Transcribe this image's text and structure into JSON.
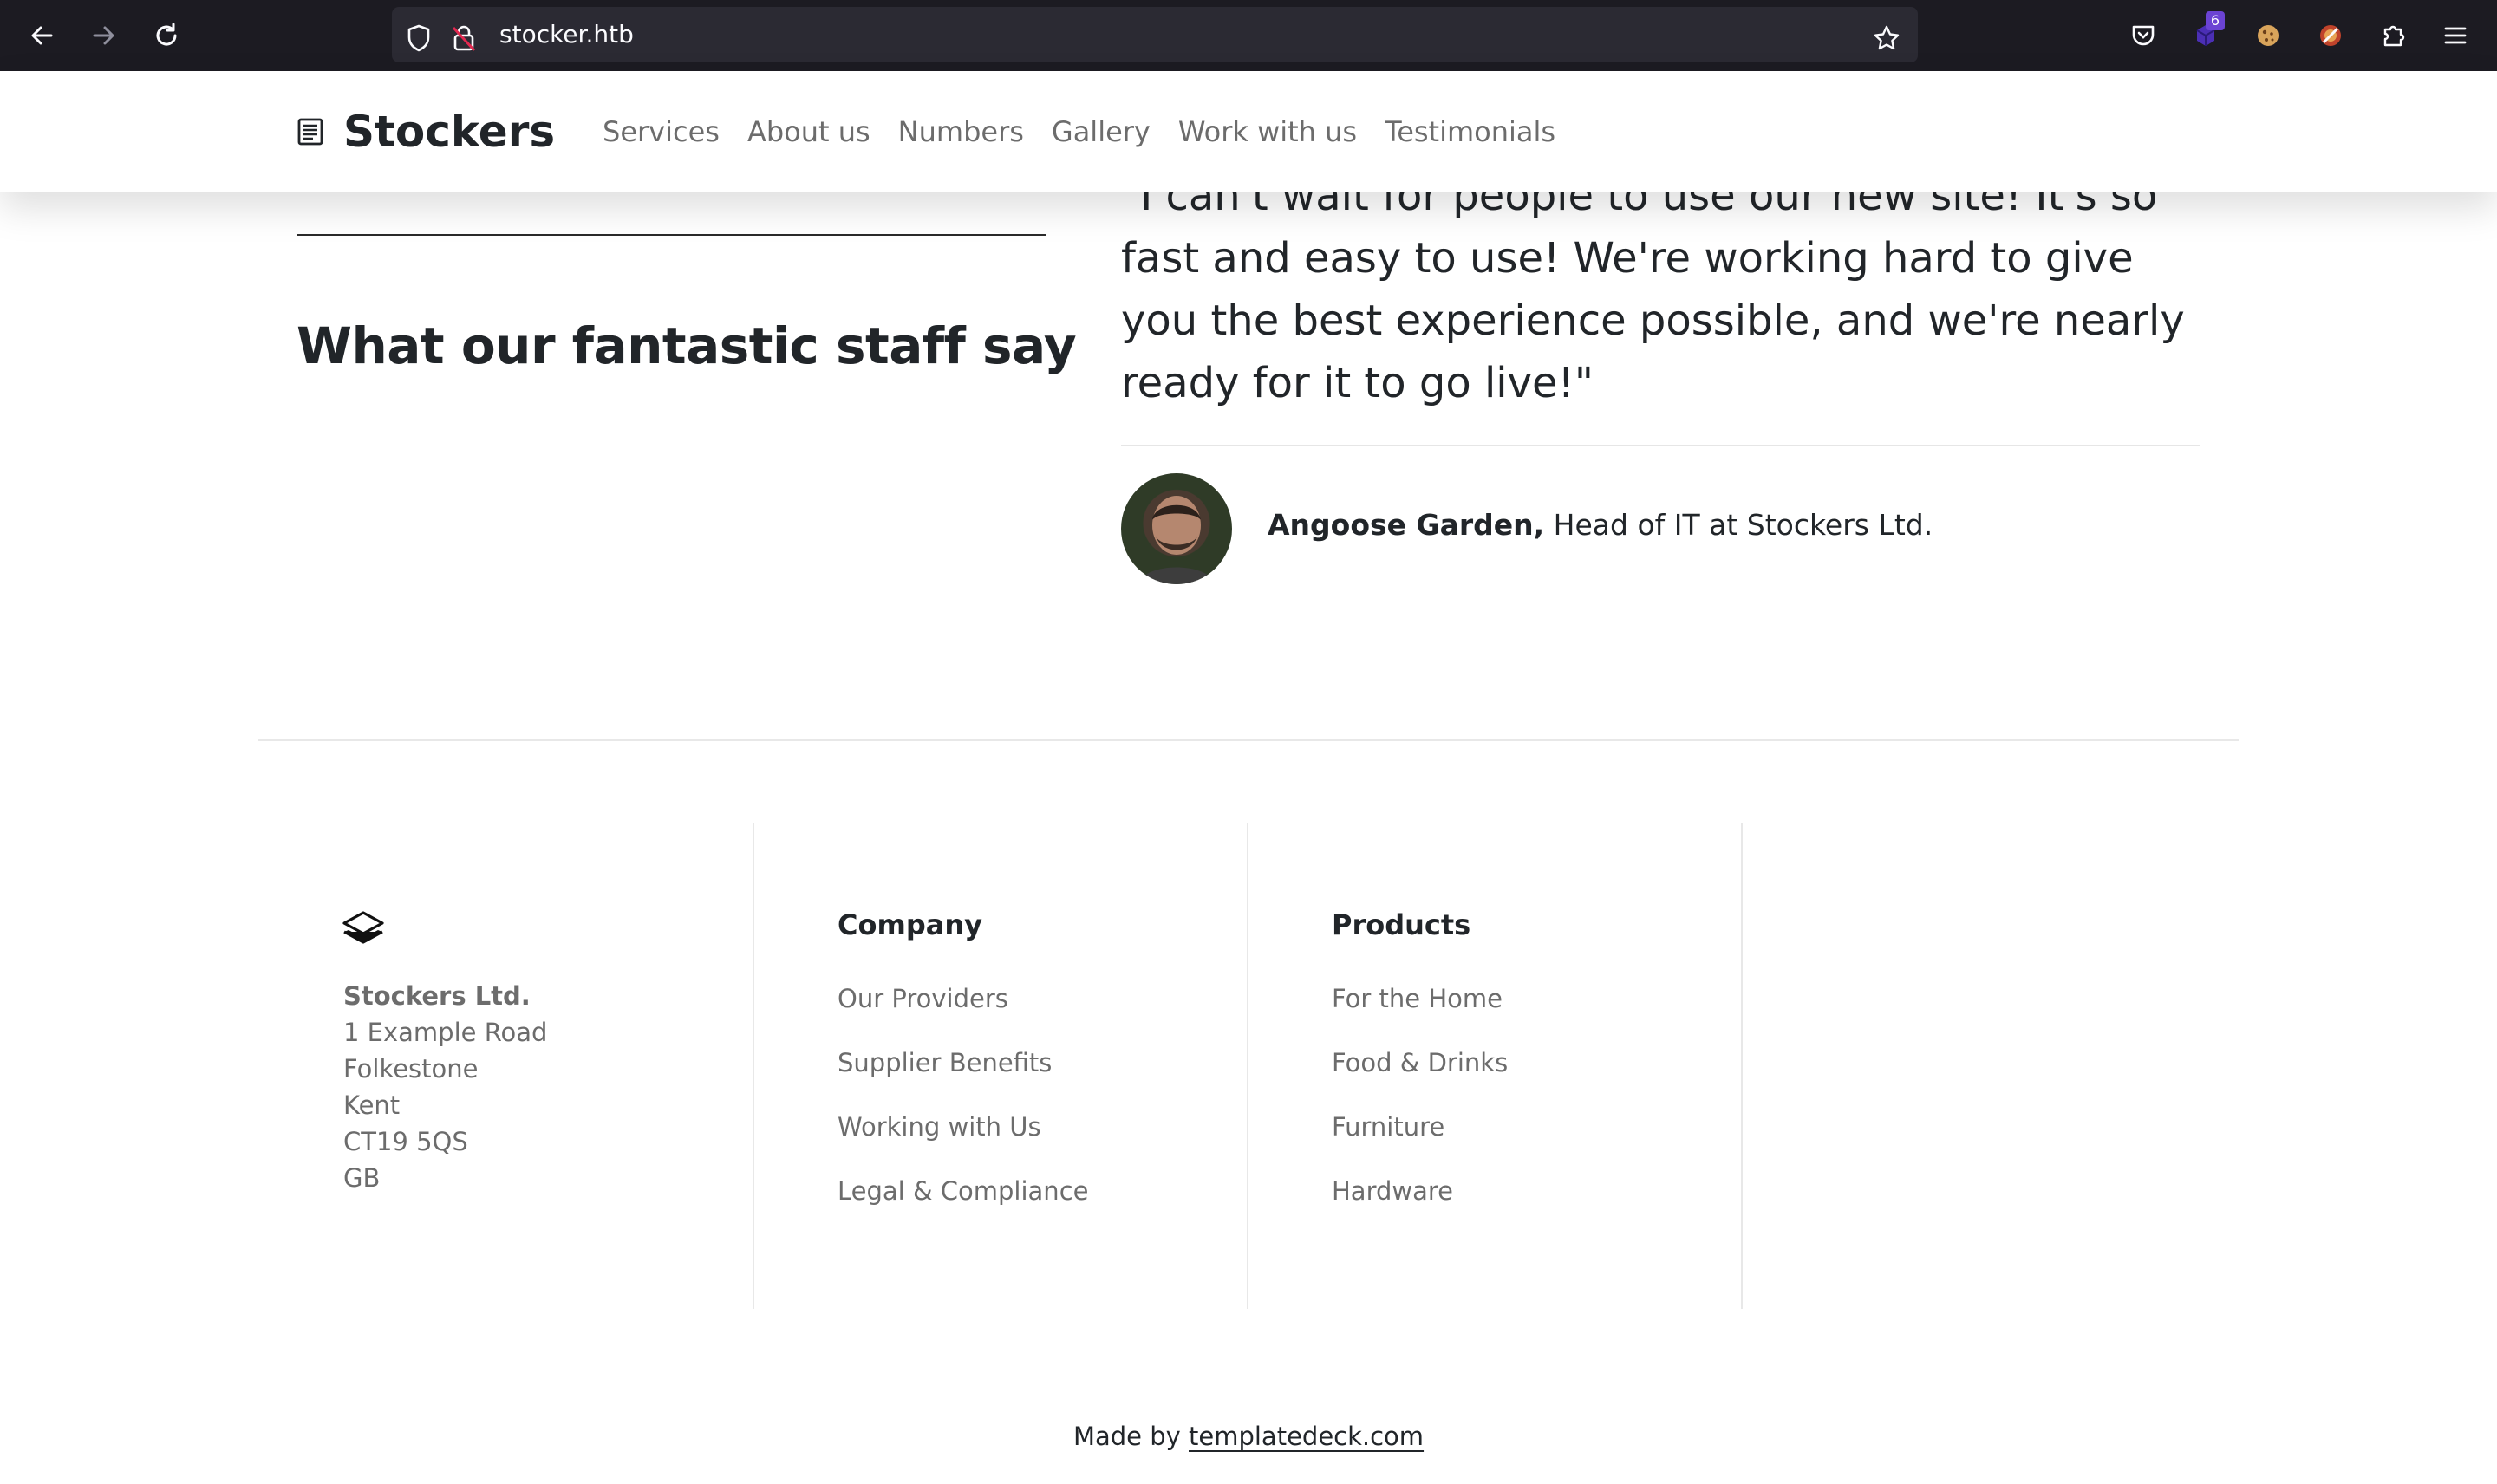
{
  "browser": {
    "url": "stocker.htb",
    "extension_badge": "6"
  },
  "header": {
    "brand": "Stockers",
    "nav": [
      "Services",
      "About us",
      "Numbers",
      "Gallery",
      "Work with us",
      "Testimonials"
    ]
  },
  "testimonials": {
    "heading": "What our fantastic staff say",
    "quote": "\"I can't wait for people to use our new site! It's so fast and easy to use! We're working hard to give you the best experience possible, and we're nearly ready for it to go live!\"",
    "author_name": "Angoose Garden,",
    "author_role": "Head of IT at Stockers Ltd."
  },
  "footer": {
    "address": [
      "Stockers Ltd.",
      "1 Example Road",
      "Folkestone",
      "Kent",
      "CT19 5QS",
      "GB"
    ],
    "company": {
      "title": "Company",
      "links": [
        "Our Providers",
        "Supplier Benefits",
        "Working with Us",
        "Legal & Compliance"
      ]
    },
    "products": {
      "title": "Products",
      "links": [
        "For the Home",
        "Food & Drinks",
        "Furniture",
        "Hardware"
      ]
    },
    "credits_prefix": "Made by",
    "credits_link": "templatedeck.com"
  },
  "colors": {
    "chrome_bg": "#1c1b22",
    "urlbar_bg": "#2b2a33",
    "text_dark": "#212529",
    "text_muted": "#6c6c6c"
  }
}
